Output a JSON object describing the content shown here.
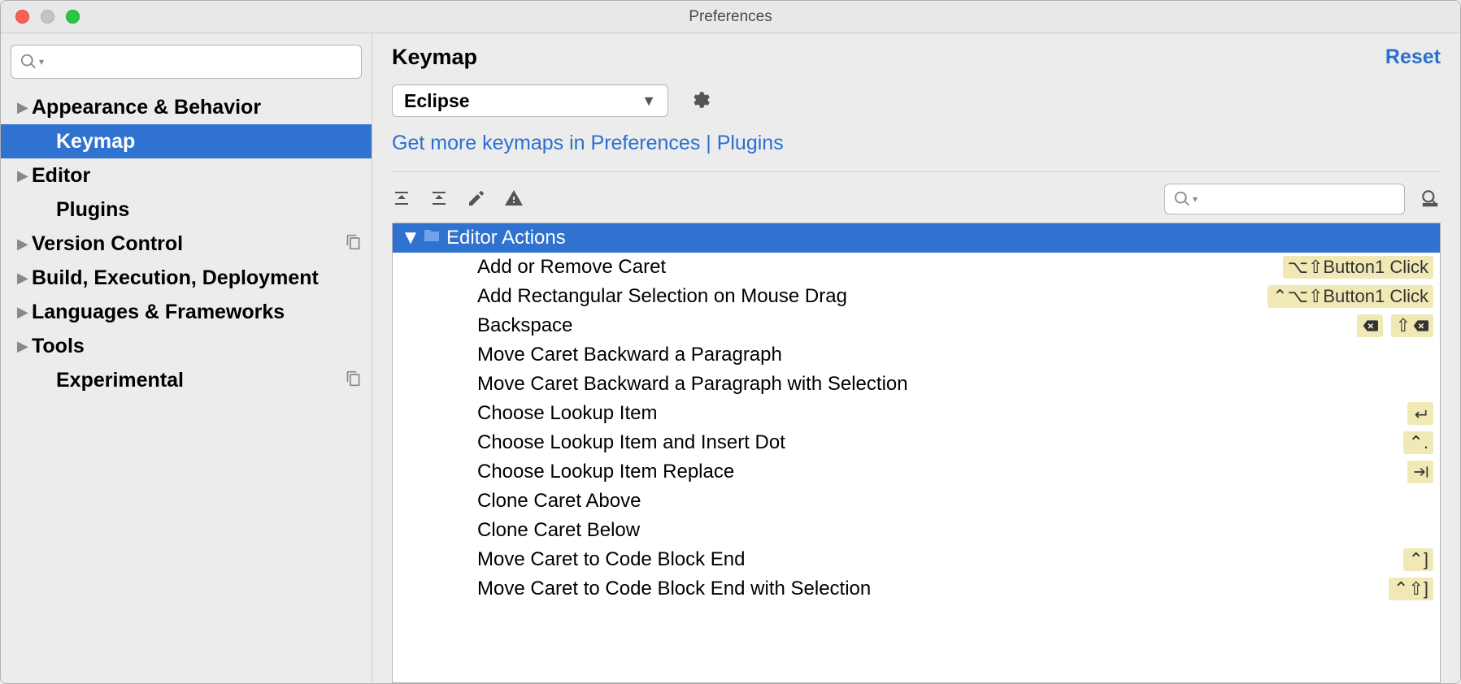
{
  "window": {
    "title": "Preferences"
  },
  "sidebar": {
    "items": [
      {
        "label": "Appearance & Behavior",
        "expandable": true,
        "selected": false,
        "indent": false,
        "copy": false
      },
      {
        "label": "Keymap",
        "expandable": false,
        "selected": true,
        "indent": true,
        "copy": false
      },
      {
        "label": "Editor",
        "expandable": true,
        "selected": false,
        "indent": false,
        "copy": false
      },
      {
        "label": "Plugins",
        "expandable": false,
        "selected": false,
        "indent": true,
        "copy": false
      },
      {
        "label": "Version Control",
        "expandable": true,
        "selected": false,
        "indent": false,
        "copy": true
      },
      {
        "label": "Build, Execution, Deployment",
        "expandable": true,
        "selected": false,
        "indent": false,
        "copy": false
      },
      {
        "label": "Languages & Frameworks",
        "expandable": true,
        "selected": false,
        "indent": false,
        "copy": false
      },
      {
        "label": "Tools",
        "expandable": true,
        "selected": false,
        "indent": false,
        "copy": false
      },
      {
        "label": "Experimental",
        "expandable": false,
        "selected": false,
        "indent": true,
        "copy": true
      }
    ]
  },
  "panel": {
    "title": "Keymap",
    "reset": "Reset",
    "keymap_select": "Eclipse",
    "more_link": "Get more keymaps in Preferences | Plugins",
    "group_label": "Editor Actions",
    "actions": [
      {
        "label": "Add or Remove Caret",
        "shortcuts": [
          "⌥⇧Button1 Click"
        ]
      },
      {
        "label": "Add Rectangular Selection on Mouse Drag",
        "shortcuts": [
          "⌃⌥⇧Button1 Click"
        ]
      },
      {
        "label": "Backspace",
        "shortcuts": [
          "⌦",
          "⇧⌦"
        ]
      },
      {
        "label": "Move Caret Backward a Paragraph",
        "shortcuts": []
      },
      {
        "label": "Move Caret Backward a Paragraph with Selection",
        "shortcuts": []
      },
      {
        "label": "Choose Lookup Item",
        "shortcuts": [
          "↩"
        ]
      },
      {
        "label": "Choose Lookup Item and Insert Dot",
        "shortcuts": [
          "⌃."
        ]
      },
      {
        "label": "Choose Lookup Item Replace",
        "shortcuts": [
          "→|"
        ]
      },
      {
        "label": "Clone Caret Above",
        "shortcuts": []
      },
      {
        "label": "Clone Caret Below",
        "shortcuts": []
      },
      {
        "label": "Move Caret to Code Block End",
        "shortcuts": [
          "⌃]"
        ]
      },
      {
        "label": "Move Caret to Code Block End with Selection",
        "shortcuts": [
          "⌃⇧]"
        ]
      }
    ]
  }
}
